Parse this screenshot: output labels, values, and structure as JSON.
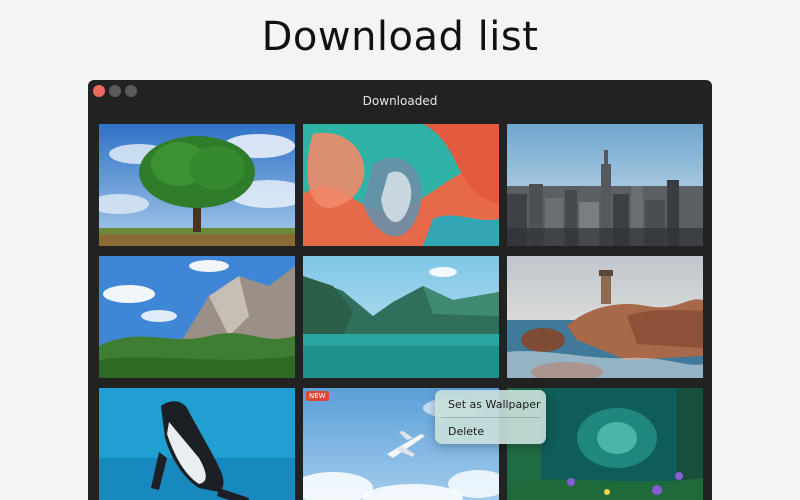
{
  "page": {
    "headline": "Download list"
  },
  "window": {
    "title": "Downloaded",
    "traffic_lights": [
      "close",
      "minimize",
      "zoom"
    ]
  },
  "gallery": {
    "badge": "NEW",
    "images": [
      {
        "subject": "tree-field"
      },
      {
        "subject": "fluid-art"
      },
      {
        "subject": "city-skyline"
      },
      {
        "subject": "mountains"
      },
      {
        "subject": "lake-valley"
      },
      {
        "subject": "coast-lighthouse"
      },
      {
        "subject": "penguin"
      },
      {
        "subject": "airplane-clouds"
      },
      {
        "subject": "fantasy-forest"
      }
    ]
  },
  "context_menu": {
    "items": [
      {
        "label": "Set as Wallpaper"
      },
      {
        "label": "Delete"
      }
    ]
  },
  "colors": {
    "close": "#ed6a5e",
    "inactive": "#5b5b5b",
    "badge": "#e0453a"
  }
}
